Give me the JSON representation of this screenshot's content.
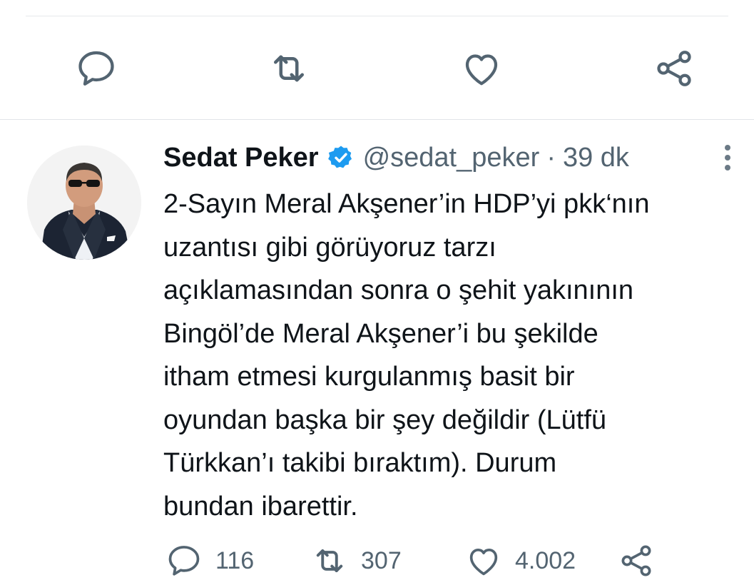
{
  "top_actions": [
    {
      "name": "reply",
      "icon": "reply-icon"
    },
    {
      "name": "retweet",
      "icon": "retweet-icon"
    },
    {
      "name": "like",
      "icon": "heart-icon"
    },
    {
      "name": "share",
      "icon": "share-icon"
    }
  ],
  "tweet": {
    "display_name": "Sedat Peker",
    "verified": true,
    "handle": "@sedat_peker",
    "separator": "·",
    "time": "39 dk",
    "text_lines": [
      "2-Sayın Meral Akşener’in HDP’yi pkk‘nın",
      "uzantısı gibi görüyoruz tarzı",
      "açıklamasından sonra o şehit yakınının",
      "Bingöl’de Meral Akşener’i bu şekilde",
      "itham etmesi kurgulanmış basit bir",
      "oyundan başka bir şey değildir (Lütfü",
      "Türkkan’ı takibi bıraktım). Durum",
      "bundan ibarettir."
    ],
    "stats": {
      "replies": "116",
      "retweets": "307",
      "likes": "4.002"
    }
  },
  "colors": {
    "icon_gray": "#536471",
    "verified_blue": "#1d9bf0",
    "divider": "#e1e5e8"
  }
}
